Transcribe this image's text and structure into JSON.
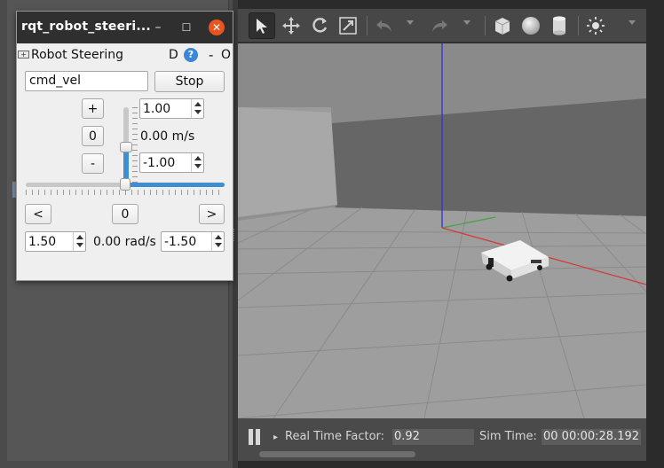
{
  "rqt_window": {
    "title": "rqt_robot_steeri...",
    "minimize_glyph": "–",
    "maximize_glyph": "☐",
    "close_glyph": "✕"
  },
  "plugin": {
    "title": "Robot Steering",
    "dock_label": "D",
    "help_label": "?",
    "minimize_label": "-",
    "close_label": "O"
  },
  "controls": {
    "topic_value": "cmd_vel",
    "stop_label": "Stop",
    "linear": {
      "inc_label": "+",
      "zero_label": "0",
      "dec_label": "-",
      "max_value": "1.00",
      "min_value": "-1.00",
      "current_text": "0.00 m/s",
      "slider_fraction": 0.5
    },
    "angular": {
      "left_label": "<",
      "zero_label": "0",
      "right_label": ">",
      "max_value": "1.50",
      "min_value": "-1.50",
      "current_text": "0.00 rad/s",
      "slider_fraction": 0.5
    }
  },
  "gazebo": {
    "toolbar_icons": [
      "select-arrow-icon",
      "translate-icon",
      "rotate-icon",
      "scale-icon",
      "undo-icon",
      "redo-icon",
      "box-icon",
      "sphere-icon",
      "cylinder-icon",
      "sun-icon"
    ],
    "status": {
      "real_time_factor_label": "Real Time Factor:",
      "real_time_factor_value": "0.92",
      "sim_time_label": "Sim Time:",
      "sim_time_value": "00 00:00:28.192"
    },
    "colors": {
      "accent_blue": "#3d8fd1",
      "close_orange": "#e95420",
      "x_axis": "#d23a3a",
      "y_axis": "#3fa648",
      "z_axis": "#2b34d6"
    }
  }
}
